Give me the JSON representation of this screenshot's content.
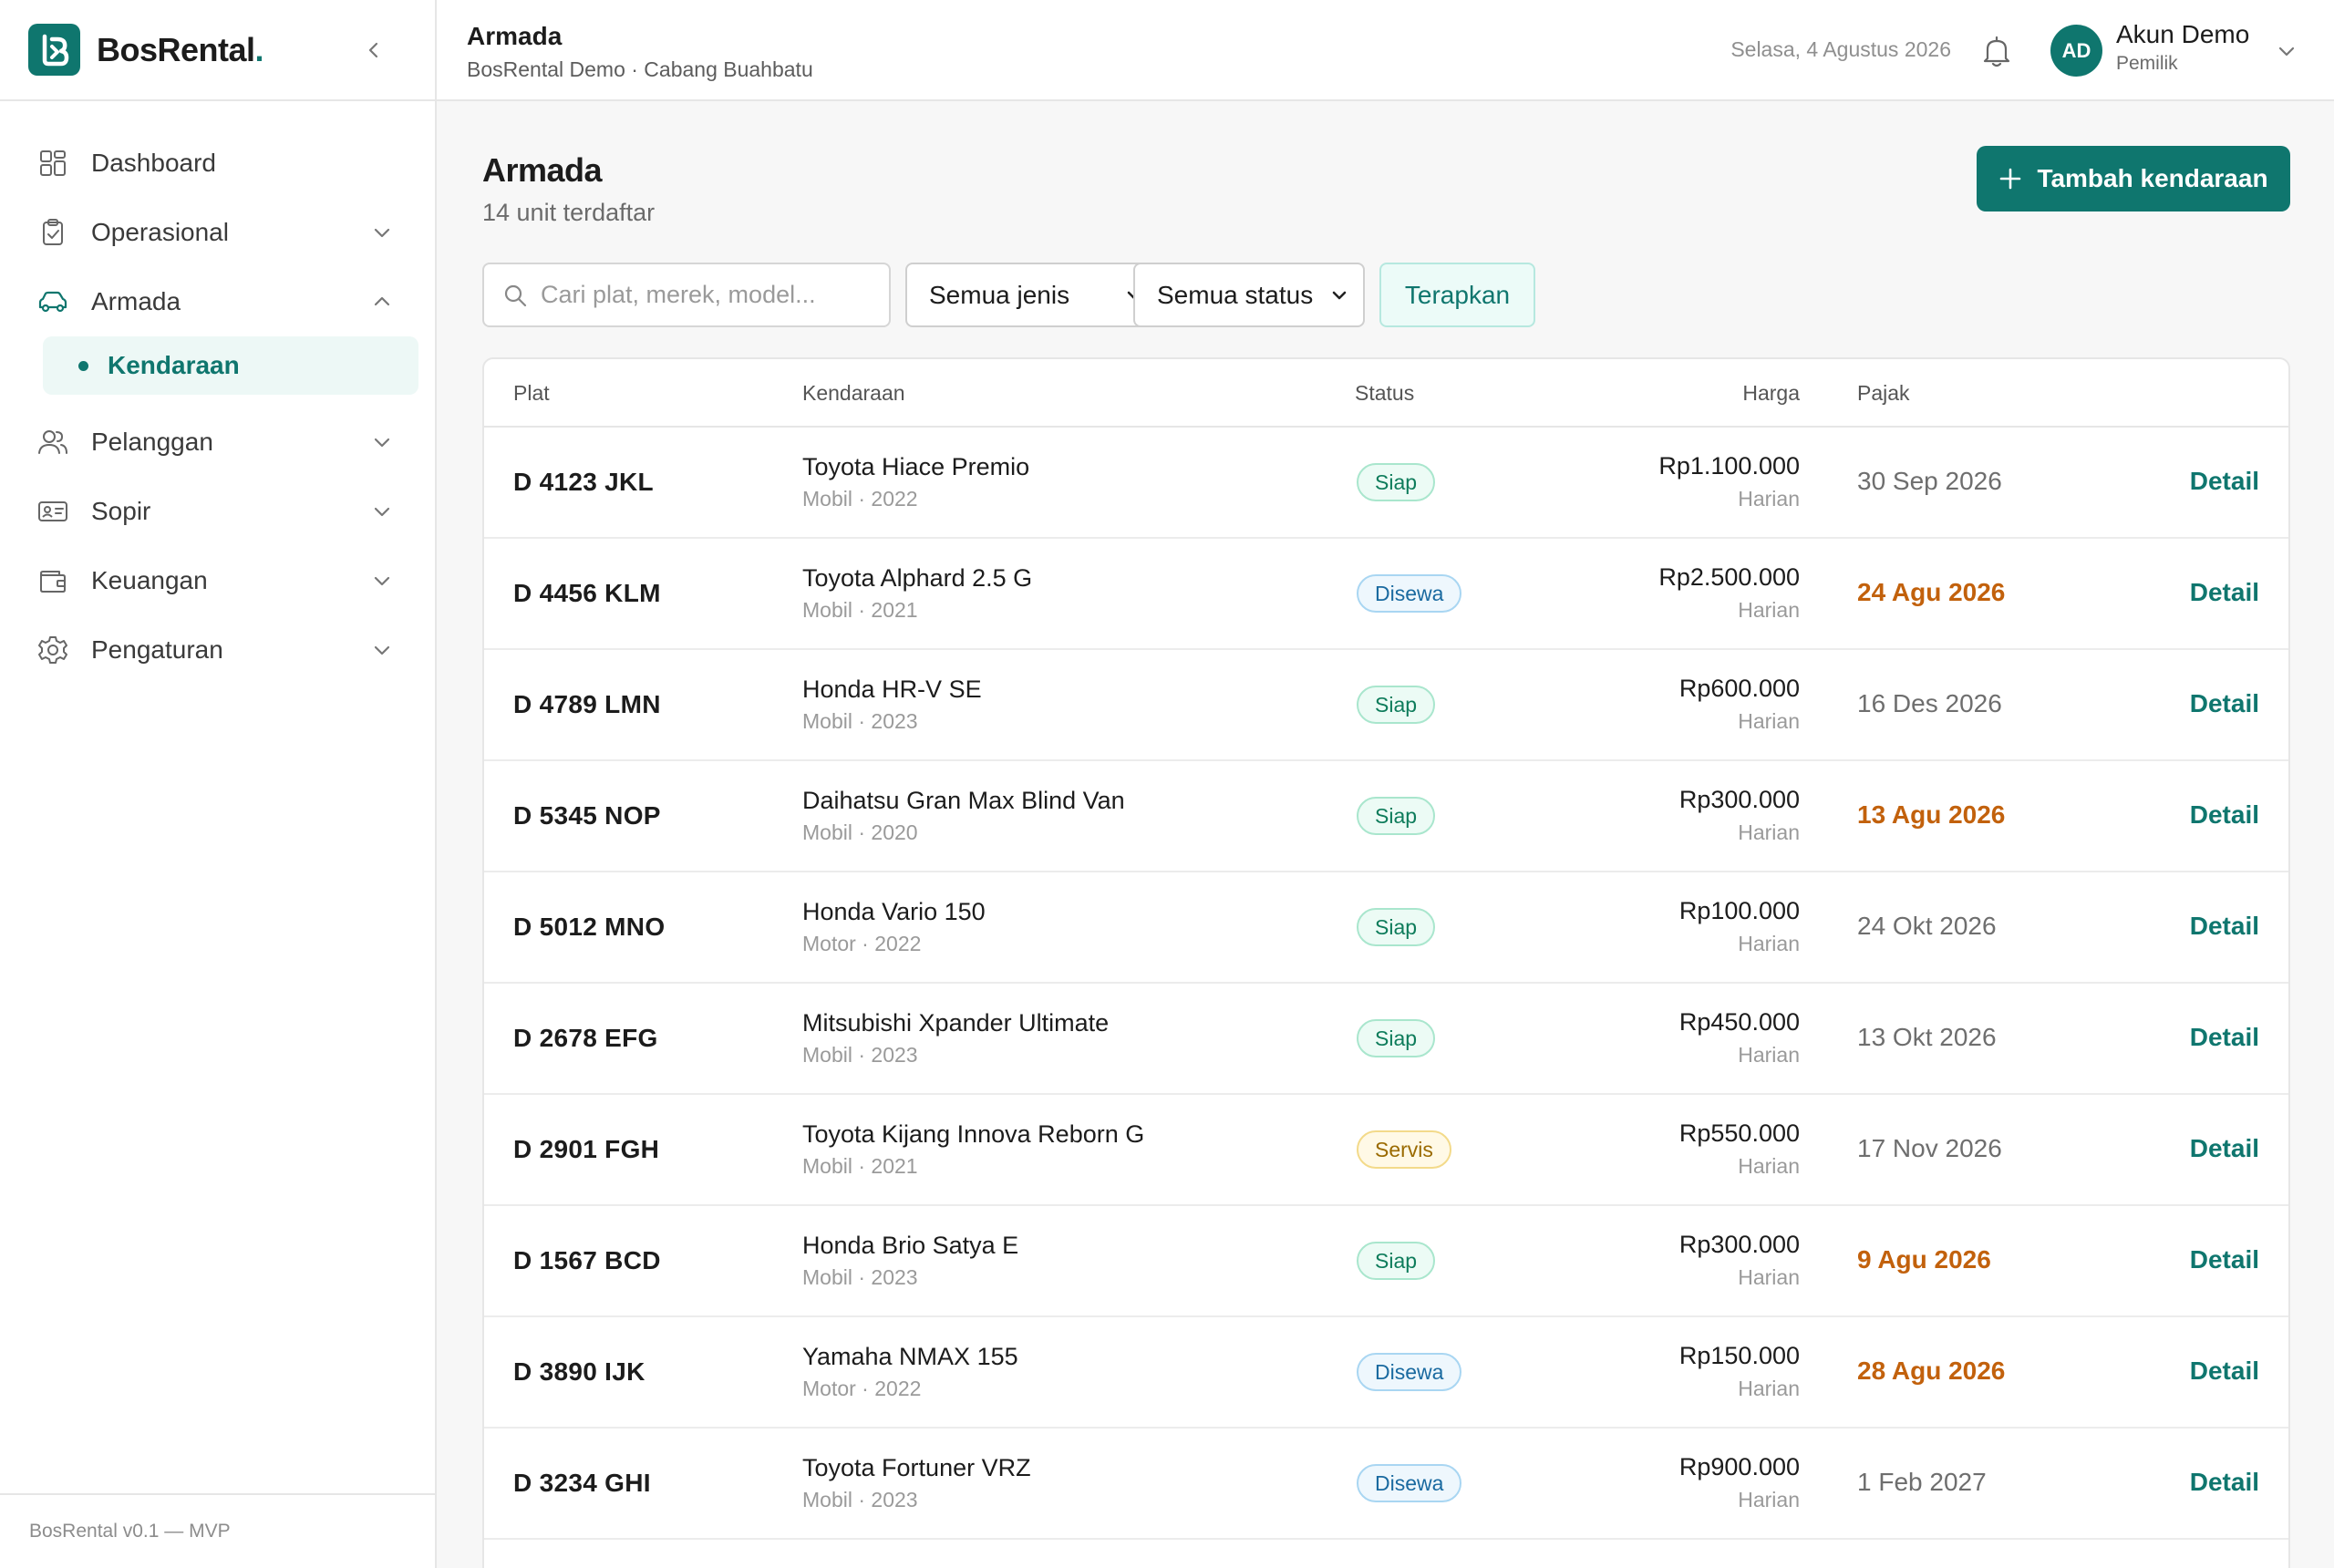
{
  "brand": {
    "name": "BosRental",
    "dot": "."
  },
  "sidebar": {
    "items": [
      {
        "label": "Dashboard",
        "icon": "dashboard-icon"
      },
      {
        "label": "Operasional",
        "icon": "clipboard-icon"
      },
      {
        "label": "Armada",
        "icon": "car-icon",
        "expanded": true
      },
      {
        "label": "Pelanggan",
        "icon": "users-icon"
      },
      {
        "label": "Sopir",
        "icon": "id-card-icon"
      },
      {
        "label": "Keuangan",
        "icon": "wallet-icon"
      },
      {
        "label": "Pengaturan",
        "icon": "gear-icon"
      }
    ],
    "sub_active": "Kendaraan",
    "footer": "BosRental v0.1 — MVP"
  },
  "topbar": {
    "title": "Armada",
    "subtitle": "BosRental Demo · Cabang Buahbatu",
    "date": "Selasa, 4 Agustus 2026",
    "avatar": "AD",
    "user_name": "Akun Demo",
    "user_role": "Pemilik"
  },
  "main": {
    "title": "Armada",
    "subtitle": "14 unit terdaftar",
    "add_button": "Tambah kendaraan",
    "search_placeholder": "Cari plat, merek, model...",
    "filter_type": "Semua jenis",
    "filter_status": "Semua status",
    "apply_button": "Terapkan"
  },
  "table": {
    "headers": {
      "plat": "Plat",
      "kendaraan": "Kendaraan",
      "status": "Status",
      "harga": "Harga",
      "pajak": "Pajak"
    },
    "detail_label": "Detail",
    "rows": [
      {
        "plat": "D 4123 JKL",
        "name": "Toyota Hiace Premio",
        "meta": "Mobil · 2022",
        "status": "Siap",
        "status_kind": "siap",
        "price": "Rp1.100.000",
        "unit": "Harian",
        "tax": "30 Sep 2026",
        "tax_warn": false
      },
      {
        "plat": "D 4456 KLM",
        "name": "Toyota Alphard 2.5 G",
        "meta": "Mobil · 2021",
        "status": "Disewa",
        "status_kind": "disewa",
        "price": "Rp2.500.000",
        "unit": "Harian",
        "tax": "24 Agu 2026",
        "tax_warn": true
      },
      {
        "plat": "D 4789 LMN",
        "name": "Honda HR-V SE",
        "meta": "Mobil · 2023",
        "status": "Siap",
        "status_kind": "siap",
        "price": "Rp600.000",
        "unit": "Harian",
        "tax": "16 Des 2026",
        "tax_warn": false
      },
      {
        "plat": "D 5345 NOP",
        "name": "Daihatsu Gran Max Blind Van",
        "meta": "Mobil · 2020",
        "status": "Siap",
        "status_kind": "siap",
        "price": "Rp300.000",
        "unit": "Harian",
        "tax": "13 Agu 2026",
        "tax_warn": true
      },
      {
        "plat": "D 5012 MNO",
        "name": "Honda Vario 150",
        "meta": "Motor · 2022",
        "status": "Siap",
        "status_kind": "siap",
        "price": "Rp100.000",
        "unit": "Harian",
        "tax": "24 Okt 2026",
        "tax_warn": false
      },
      {
        "plat": "D 2678 EFG",
        "name": "Mitsubishi Xpander Ultimate",
        "meta": "Mobil · 2023",
        "status": "Siap",
        "status_kind": "siap",
        "price": "Rp450.000",
        "unit": "Harian",
        "tax": "13 Okt 2026",
        "tax_warn": false
      },
      {
        "plat": "D 2901 FGH",
        "name": "Toyota Kijang Innova Reborn G",
        "meta": "Mobil · 2021",
        "status": "Servis",
        "status_kind": "servis",
        "price": "Rp550.000",
        "unit": "Harian",
        "tax": "17 Nov 2026",
        "tax_warn": false
      },
      {
        "plat": "D 1567 BCD",
        "name": "Honda Brio Satya E",
        "meta": "Mobil · 2023",
        "status": "Siap",
        "status_kind": "siap",
        "price": "Rp300.000",
        "unit": "Harian",
        "tax": "9 Agu 2026",
        "tax_warn": true
      },
      {
        "plat": "D 3890 IJK",
        "name": "Yamaha NMAX 155",
        "meta": "Motor · 2022",
        "status": "Disewa",
        "status_kind": "disewa",
        "price": "Rp150.000",
        "unit": "Harian",
        "tax": "28 Agu 2026",
        "tax_warn": true
      },
      {
        "plat": "D 3234 GHI",
        "name": "Toyota Fortuner VRZ",
        "meta": "Mobil · 2023",
        "status": "Disewa",
        "status_kind": "disewa",
        "price": "Rp900.000",
        "unit": "Harian",
        "tax": "1 Feb 2027",
        "tax_warn": false
      }
    ]
  },
  "colors": {
    "accent": "#0f766e",
    "warn": "#c2610c"
  }
}
